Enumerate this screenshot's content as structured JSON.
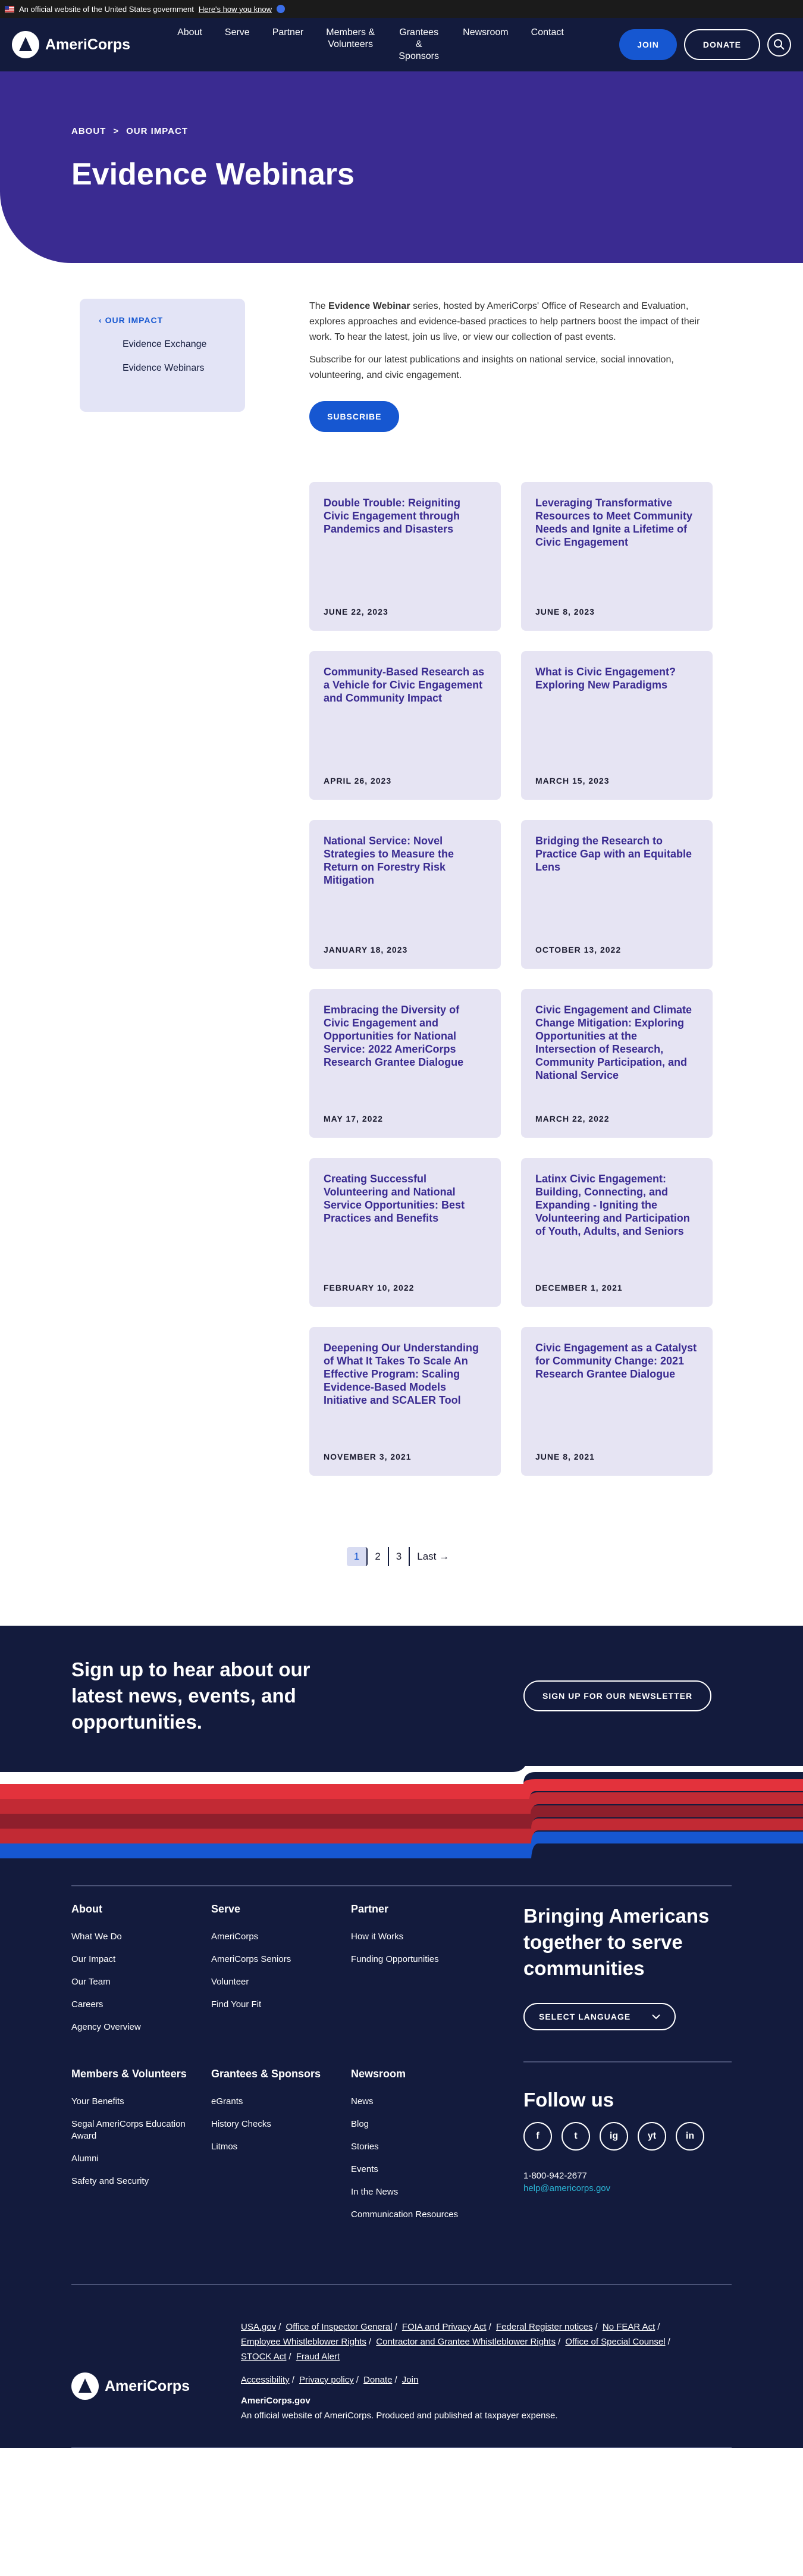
{
  "gov_banner": {
    "text": "An official website of the United States government",
    "link": "Here's how you know"
  },
  "header": {
    "logo": "AmeriCorps",
    "nav": [
      "About",
      "Serve",
      "Partner",
      "Members & Volunteers",
      "Grantees & Sponsors",
      "Newsroom",
      "Contact"
    ],
    "join": "JOIN",
    "donate": "DONATE"
  },
  "hero": {
    "crumb1": "ABOUT",
    "crumb_sep": ">",
    "crumb2": "OUR IMPACT",
    "title": "Evidence Webinars"
  },
  "sidebar": {
    "back": "OUR IMPACT",
    "items": [
      "Evidence Exchange",
      "Evidence Webinars"
    ]
  },
  "intro": {
    "p1_pre": "The ",
    "p1_bold": "Evidence Webinar",
    "p1_post": " series, hosted by AmeriCorps' Office of Research and Evaluation, explores approaches and evidence-based practices to help partners boost the impact of their work. To hear the latest, join us live, or view our collection of past events.",
    "p2": "Subscribe for our latest publications and insights on national service, social innovation, volunteering, and civic engagement.",
    "subscribe": "SUBSCRIBE"
  },
  "cards": [
    {
      "title": "Double Trouble: Reigniting Civic Engagement through Pandemics and Disasters",
      "date": "JUNE 22, 2023"
    },
    {
      "title": "Leveraging Transformative Resources to Meet Community Needs and Ignite a Lifetime of Civic Engagement",
      "date": "JUNE 8, 2023"
    },
    {
      "title": "Community-Based Research as a Vehicle for Civic Engagement and Community Impact",
      "date": "APRIL 26, 2023"
    },
    {
      "title": "What is Civic Engagement? Exploring New Paradigms",
      "date": "MARCH 15, 2023"
    },
    {
      "title": "National Service: Novel Strategies to Measure the Return on Forestry Risk Mitigation",
      "date": "JANUARY 18, 2023"
    },
    {
      "title": "Bridging the Research to Practice Gap with an Equitable Lens",
      "date": "OCTOBER 13, 2022"
    },
    {
      "title": "Embracing the Diversity of Civic Engagement and Opportunities for National Service: 2022 AmeriCorps Research Grantee Dialogue",
      "date": "MAY 17, 2022"
    },
    {
      "title": "Civic Engagement and Climate Change Mitigation: Exploring Opportunities at the Intersection of Research, Community Participation, and National Service",
      "date": "MARCH 22, 2022"
    },
    {
      "title": "Creating Successful Volunteering and National Service Opportunities: Best Practices and Benefits",
      "date": "FEBRUARY 10, 2022"
    },
    {
      "title": "Latinx Civic Engagement: Building, Connecting, and Expanding - Igniting the Volunteering and Participation of Youth, Adults, and Seniors",
      "date": "DECEMBER 1, 2021"
    },
    {
      "title": "Deepening Our Understanding of What It Takes To Scale An Effective Program: Scaling Evidence-Based Models Initiative and SCALER Tool",
      "date": "NOVEMBER 3, 2021"
    },
    {
      "title": "Civic Engagement as a Catalyst for Community Change: 2021 Research Grantee Dialogue",
      "date": "JUNE 8, 2021"
    }
  ],
  "pager": {
    "p1": "1",
    "p2": "2",
    "p3": "3",
    "last": "Last →"
  },
  "signup": {
    "title": "Sign up to hear about our latest news, events, and opportunities.",
    "button": "SIGN UP FOR OUR NEWSLETTER"
  },
  "footer": {
    "cols": [
      {
        "title": "About",
        "links": [
          "What We Do",
          "Our Impact",
          "Our Team",
          "Careers",
          "Agency Overview"
        ]
      },
      {
        "title": "Serve",
        "links": [
          "AmeriCorps",
          "AmeriCorps Seniors",
          "Volunteer",
          "Find Your Fit"
        ]
      },
      {
        "title": "Partner",
        "links": [
          "How it Works",
          "Funding Opportunities"
        ]
      },
      {
        "title": "Members & Volunteers",
        "links": [
          "Your Benefits",
          "Segal AmeriCorps Education Award",
          "Alumni",
          "Safety and Security"
        ]
      },
      {
        "title": "Grantees & Sponsors",
        "links": [
          "eGrants",
          "History Checks",
          "Litmos"
        ]
      },
      {
        "title": "Newsroom",
        "links": [
          "News",
          "Blog",
          "Stories",
          "Events",
          "In the News",
          "Communication Resources"
        ]
      }
    ],
    "tagline": "Bringing Americans together to serve communities",
    "language": "SELECT LANGUAGE",
    "follow": "Follow us",
    "social": [
      "f",
      "t",
      "ig",
      "yt",
      "in"
    ],
    "phone": "1-800-942-2677",
    "email": "help@americorps.gov",
    "legal_links": [
      "USA.gov",
      "Office of Inspector General",
      "FOIA and Privacy Act",
      "Federal Register notices",
      "No FEAR Act",
      "Employee Whistleblower Rights",
      "Contractor and Grantee Whistleblower Rights",
      "Office of Special Counsel",
      "STOCK Act",
      "Fraud Alert"
    ],
    "policy_links": [
      "Accessibility",
      "Privacy policy",
      "Donate",
      "Join"
    ],
    "site": "AmeriCorps.gov",
    "official": "An official website of AmeriCorps. Produced and published at taxpayer expense."
  }
}
